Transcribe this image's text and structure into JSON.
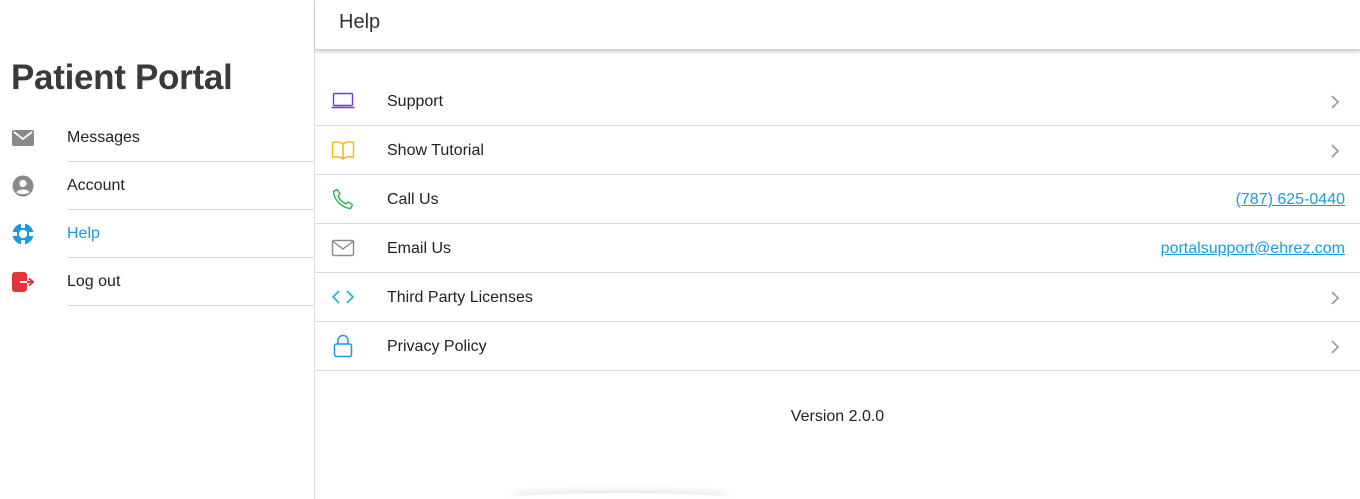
{
  "sidebar": {
    "brand": "Patient Portal",
    "items": [
      {
        "label": "Messages",
        "icon": "envelope-icon",
        "color": "#8a8a8a"
      },
      {
        "label": "Account",
        "icon": "account-circle-icon",
        "color": "#8a8a8a"
      },
      {
        "label": "Help",
        "icon": "lifebuoy-icon",
        "color": "#1a9be0",
        "active": true
      },
      {
        "label": "Log out",
        "icon": "logout-icon",
        "color": "#e8333a"
      }
    ]
  },
  "header": {
    "title": "Help"
  },
  "help": {
    "rows": [
      {
        "label": "Support",
        "icon": "laptop-icon",
        "color": "#6a3fd6",
        "action": "chevron"
      },
      {
        "label": "Show Tutorial",
        "icon": "book-icon",
        "color": "#f2b705",
        "action": "chevron"
      },
      {
        "label": "Call Us",
        "icon": "phone-icon",
        "color": "#2bb24c",
        "link": "(787) 625-0440"
      },
      {
        "label": "Email Us",
        "icon": "envelope-outline-icon",
        "color": "#8a8a8a",
        "link": "portalsupport@ehrez.com"
      },
      {
        "label": "Third Party Licenses",
        "icon": "code-icon",
        "color": "#19b6d2",
        "action": "chevron"
      },
      {
        "label": "Privacy Policy",
        "icon": "lock-icon",
        "color": "#1a9be0",
        "action": "chevron"
      }
    ]
  },
  "footer": {
    "version": "Version 2.0.0"
  },
  "colors": {
    "accent": "#1a9be0",
    "divider": "#d9d9d9"
  }
}
